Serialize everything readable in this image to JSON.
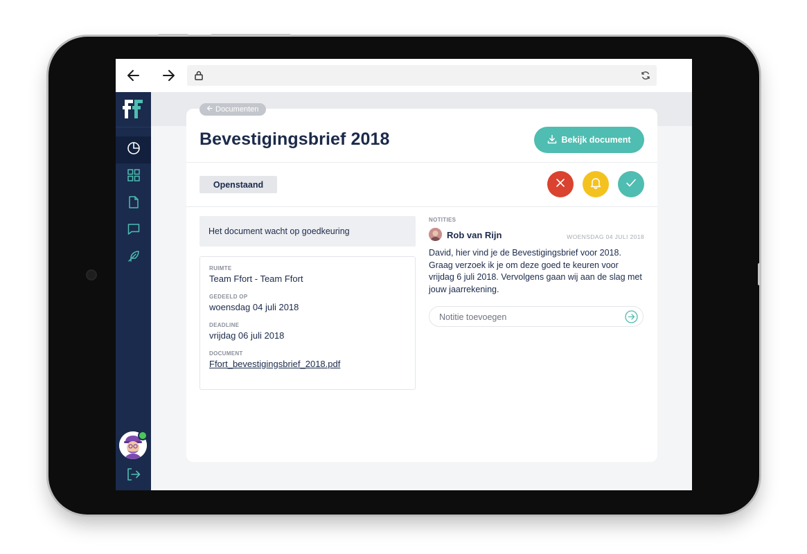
{
  "theme": {
    "sidebar_bg": "#1a2b4d",
    "accent": "#4fbdb1",
    "reject": "#d9432f",
    "remind": "#f4c21f",
    "approve": "#4fbdb1",
    "text": "#1b2a4a"
  },
  "browser": {
    "back_icon": "arrow-left-icon",
    "forward_icon": "arrow-right-icon",
    "lock_icon": "lock-icon",
    "reload_icon": "reload-icon"
  },
  "sidebar": {
    "logo_icon": "ffort-logo-icon",
    "items": [
      {
        "icon": "pie-chart-icon",
        "active": true
      },
      {
        "icon": "grid-icon",
        "active": false
      },
      {
        "icon": "document-icon",
        "active": false
      },
      {
        "icon": "chat-bubble-icon",
        "active": false
      },
      {
        "icon": "feather-icon",
        "active": false
      }
    ],
    "avatar_icon": "user-avatar",
    "logout_icon": "logout-icon"
  },
  "breadcrumb": {
    "label": "Documenten"
  },
  "document": {
    "title": "Bevestigingsbrief 2018",
    "view_button": "Bekijk document",
    "status": "Openstaand",
    "info": "Het document wacht op goedkeuring",
    "details": [
      {
        "label": "RUIMTE",
        "value": "Team Ffort - Team Ffort"
      },
      {
        "label": "GEDEELD OP",
        "value": "woensdag 04 juli 2018"
      },
      {
        "label": "DEADLINE",
        "value": "vrijdag 06 juli 2018"
      },
      {
        "label": "DOCUMENT",
        "value": "Ffort_bevestigingsbrief_2018.pdf"
      }
    ]
  },
  "actions": {
    "reject_icon": "close-icon",
    "remind_icon": "bell-icon",
    "approve_icon": "check-icon"
  },
  "notes": {
    "label": "NOTITIES",
    "author": "Rob van Rijn",
    "date": "WOENSDAG 04 JULI 2018",
    "body": "David, hier vind je de Bevestigingsbrief voor 2018. Graag verzoek ik je om deze goed te keuren voor vrijdag 6 juli 2018. Vervolgens gaan wij aan de slag met jouw jaarrekening.",
    "input_placeholder": "Notitie toevoegen",
    "send_icon": "send-arrow-icon"
  }
}
